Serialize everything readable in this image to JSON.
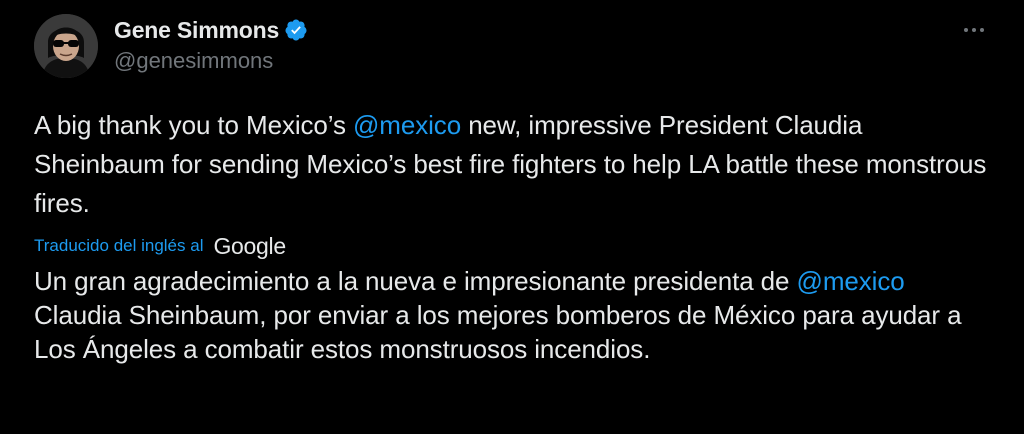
{
  "author": {
    "display_name": "Gene Simmons",
    "handle": "@genesimmons",
    "avatar_icon": "person-with-sunglasses-avatar",
    "verified_icon": "verified-badge-icon",
    "verified_color": "#1d9bf0"
  },
  "more_icon": "more-horizontal-icon",
  "tweet": {
    "text_before": "A big thank you to Mexico’s ",
    "mention": "@mexico",
    "text_after": " new, impressive President Claudia Sheinbaum for sending Mexico’s best fire fighters to help LA battle these monstrous fires."
  },
  "translation": {
    "label": "Traducido del inglés al",
    "provider": "Google",
    "text_before": "Un gran agradecimiento a la nueva e impresionante presidenta de ",
    "mention": "@mexico",
    "text_after": " Claudia Sheinbaum, por enviar a los mejores bomberos de México para ayudar a Los Ángeles a combatir estos monstruosos incendios."
  },
  "colors": {
    "background": "#000000",
    "text": "#e7e9ea",
    "secondary_text": "#71767b",
    "link": "#1d9bf0"
  }
}
